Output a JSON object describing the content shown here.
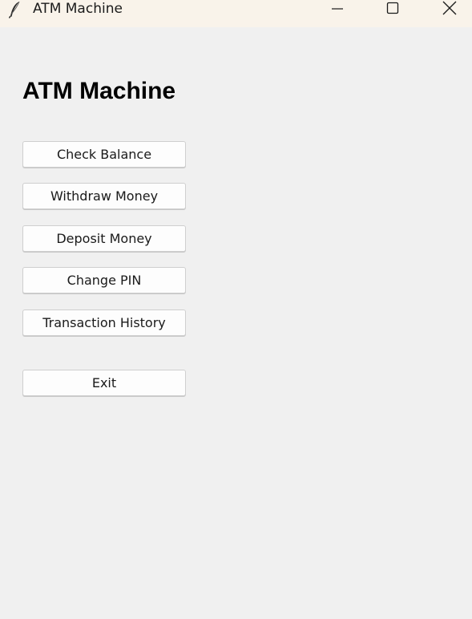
{
  "window": {
    "title": "ATM Machine",
    "icon": "feather-icon",
    "controls": {
      "minimize_icon": "minimize-icon",
      "maximize_icon": "maximize-icon",
      "close_icon": "close-icon"
    }
  },
  "main": {
    "heading": "ATM Machine",
    "buttons": [
      {
        "label": "Check Balance"
      },
      {
        "label": "Withdraw Money"
      },
      {
        "label": "Deposit Money"
      },
      {
        "label": "Change PIN"
      },
      {
        "label": "Transaction History"
      }
    ],
    "exit_label": "Exit"
  },
  "colors": {
    "titlebar_bg": "#f9f3ea",
    "window_bg": "#f0f0f0",
    "button_bg": "#fdfdfd",
    "button_border": "#cfcfcf"
  }
}
